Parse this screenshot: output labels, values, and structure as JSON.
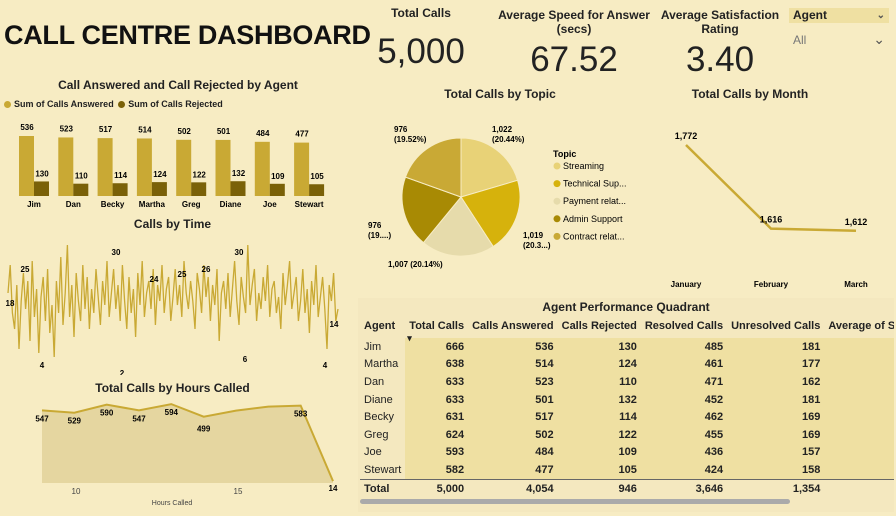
{
  "dashboard_title": "CALL CENTRE DASHBOARD",
  "colors": {
    "background": "#f7ecc3",
    "gold": "#c9a934",
    "dark": "#7a6108",
    "light": "#e8d98c",
    "pale": "#efe0a2"
  },
  "cards": [
    {
      "label": "Total Calls",
      "value": "5,000"
    },
    {
      "label": "Average Speed for Answer (secs)",
      "value": "67.52"
    },
    {
      "label": "Average Satisfaction Rating",
      "value": "3.40"
    }
  ],
  "slicer": {
    "label": "Agent",
    "value": "All",
    "icon": "chevron-down-icon"
  },
  "agent_chart": {
    "title": "Call Answered and Call Rejected by Agent",
    "legend": [
      "Sum of Calls Answered",
      "Sum of Calls Rejected"
    ],
    "agents": [
      "Jim",
      "Dan",
      "Becky",
      "Martha",
      "Greg",
      "Diane",
      "Joe",
      "Stewart"
    ],
    "answered": [
      536,
      523,
      517,
      514,
      502,
      501,
      484,
      477
    ],
    "rejected": [
      130,
      110,
      114,
      124,
      122,
      132,
      109,
      105
    ]
  },
  "time_chart": {
    "title": "Calls by Time",
    "labels": [
      "18",
      "25",
      "4",
      "2",
      "30",
      "24",
      "25",
      "26",
      "6",
      "30",
      "4",
      "14"
    ]
  },
  "hours_chart": {
    "title": "Total Calls by Hours Called",
    "xlabel": "Hours Called",
    "ticks": [
      "10",
      "15"
    ],
    "labels": [
      "547",
      "529",
      "590",
      "547",
      "594",
      "499",
      "583",
      "14"
    ]
  },
  "topic_chart": {
    "title": "Total Calls by Topic",
    "legend_title": "Topic",
    "topics": [
      "Streaming",
      "Technical Sup...",
      "Payment relat...",
      "Admin Support",
      "Contract relat..."
    ],
    "labels": [
      "1,022\n(20.44%)",
      "1,019\n(20.3...)",
      "1,007 (20.14%)",
      "976\n(19....)",
      "976\n(19.52%)"
    ]
  },
  "chart_data": [
    {
      "type": "bar",
      "title": "Call Answered and Call Rejected by Agent",
      "categories": [
        "Jim",
        "Dan",
        "Becky",
        "Martha",
        "Greg",
        "Diane",
        "Joe",
        "Stewart"
      ],
      "series": [
        {
          "name": "Sum of Calls Answered",
          "values": [
            536,
            523,
            517,
            514,
            502,
            501,
            484,
            477
          ]
        },
        {
          "name": "Sum of Calls Rejected",
          "values": [
            130,
            110,
            114,
            124,
            122,
            132,
            109,
            105
          ]
        }
      ]
    },
    {
      "type": "line",
      "title": "Calls by Time",
      "y": [
        18,
        25,
        13,
        9,
        20,
        4,
        16,
        23,
        14,
        21,
        6,
        26,
        12,
        19,
        3,
        17,
        22,
        11,
        24,
        8,
        15,
        2,
        21,
        13,
        27,
        10,
        18,
        30,
        12,
        20,
        7,
        23,
        16,
        11,
        25,
        14,
        22,
        9,
        19,
        13,
        24,
        17,
        10,
        21,
        15,
        26,
        12,
        18,
        24,
        14,
        20,
        11,
        25,
        16,
        9,
        22,
        13,
        19,
        7,
        23,
        15,
        26,
        12,
        18,
        21,
        14,
        24,
        10,
        20,
        16,
        25,
        13,
        19,
        22,
        11,
        17,
        24,
        15,
        20,
        12,
        26,
        18,
        14,
        21,
        16,
        9,
        23,
        19,
        13,
        25,
        17,
        22,
        11,
        20,
        15,
        24,
        6,
        18,
        21,
        14,
        23,
        12,
        19,
        26,
        16,
        10,
        22,
        17,
        13,
        30,
        15,
        20,
        24,
        11,
        18,
        14,
        22,
        16,
        25,
        12,
        19,
        21,
        13,
        17,
        9,
        23,
        15,
        20,
        26,
        14,
        18,
        22,
        11,
        16,
        24,
        13,
        19,
        8,
        21,
        15,
        25,
        12,
        17,
        22,
        14,
        4,
        20,
        16,
        23,
        11,
        14
      ]
    },
    {
      "type": "area",
      "title": "Total Calls by Hours Called",
      "xlabel": "Hours Called",
      "x": [
        9,
        10,
        11,
        12,
        13,
        14,
        15,
        16,
        17,
        18
      ],
      "y": [
        547,
        529,
        590,
        547,
        594,
        499,
        545,
        575,
        583,
        14
      ]
    },
    {
      "type": "pie",
      "title": "Total Calls by Topic",
      "categories": [
        "Streaming",
        "Technical Sup...",
        "Payment relat...",
        "Admin Support",
        "Contract relat..."
      ],
      "values": [
        1022,
        1019,
        1007,
        976,
        976
      ]
    },
    {
      "type": "line",
      "title": "Total Calls by Month",
      "categories": [
        "January",
        "February",
        "March"
      ],
      "values": [
        1772,
        1616,
        1612
      ]
    },
    {
      "type": "table",
      "title": "Agent Performance Quadrant",
      "columns": [
        "Agent",
        "Total Calls",
        "Calls Answered",
        "Calls Rejected",
        "Resolved Calls",
        "Unresolved Calls",
        "Average of Spe"
      ],
      "rows": [
        [
          "Jim",
          "666",
          "536",
          "130",
          "485",
          "181",
          ""
        ],
        [
          "Martha",
          "638",
          "514",
          "124",
          "461",
          "177",
          ""
        ],
        [
          "Dan",
          "633",
          "523",
          "110",
          "471",
          "162",
          ""
        ],
        [
          "Diane",
          "633",
          "501",
          "132",
          "452",
          "181",
          ""
        ],
        [
          "Becky",
          "631",
          "517",
          "114",
          "462",
          "169",
          ""
        ],
        [
          "Greg",
          "624",
          "502",
          "122",
          "455",
          "169",
          ""
        ],
        [
          "Joe",
          "593",
          "484",
          "109",
          "436",
          "157",
          ""
        ],
        [
          "Stewart",
          "582",
          "477",
          "105",
          "424",
          "158",
          ""
        ]
      ],
      "total": [
        "Total",
        "5,000",
        "4,054",
        "946",
        "3,646",
        "1,354",
        ""
      ]
    }
  ],
  "month_chart": {
    "title": "Total Calls by Month",
    "months": [
      "January",
      "February",
      "March"
    ],
    "labels": [
      "1,772",
      "1,616",
      "1,612"
    ]
  },
  "table": {
    "title": "Agent Performance Quadrant",
    "columns": [
      "Agent",
      "Total Calls",
      "Calls Answered",
      "Calls Rejected",
      "Resolved Calls",
      "Unresolved Calls",
      "Average of Spe"
    ],
    "rows": [
      [
        "Jim",
        "666",
        "536",
        "130",
        "485",
        "181"
      ],
      [
        "Martha",
        "638",
        "514",
        "124",
        "461",
        "177"
      ],
      [
        "Dan",
        "633",
        "523",
        "110",
        "471",
        "162"
      ],
      [
        "Diane",
        "633",
        "501",
        "132",
        "452",
        "181"
      ],
      [
        "Becky",
        "631",
        "517",
        "114",
        "462",
        "169"
      ],
      [
        "Greg",
        "624",
        "502",
        "122",
        "455",
        "169"
      ],
      [
        "Joe",
        "593",
        "484",
        "109",
        "436",
        "157"
      ],
      [
        "Stewart",
        "582",
        "477",
        "105",
        "424",
        "158"
      ]
    ],
    "total": [
      "Total",
      "5,000",
      "4,054",
      "946",
      "3,646",
      "1,354"
    ],
    "sort_icon": "sort-desc-icon"
  }
}
